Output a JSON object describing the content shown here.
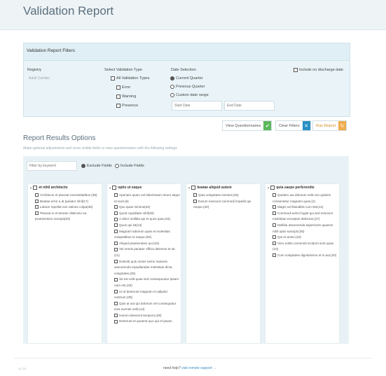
{
  "page": {
    "title": "Validation Report"
  },
  "filters": {
    "title": "Validation Report Filters",
    "registry": {
      "label": "Registry",
      "value": "Adult Cardiac"
    },
    "validation_type": {
      "label": "Select Validation Type",
      "all": "All Validation Types",
      "options": [
        "Error",
        "Warning",
        "Presence"
      ]
    },
    "date_selection": {
      "label": "Date Selection",
      "options": [
        "Current Quarter",
        "Previous Quarter",
        "Custom date range"
      ],
      "start_placeholder": "Start Date",
      "end_placeholder": "End Date"
    },
    "include_no_discharge": "Include no discharge date"
  },
  "buttons": {
    "view_questionnaires": "View Questionnaires",
    "clear_filters": "Clear Filters",
    "run_report": "Run Report",
    "colors": {
      "green": "#5cb85c",
      "blue": "#2a8fc4",
      "orange": "#f0ad4e"
    }
  },
  "results": {
    "title": "Report Results Options",
    "subtitle": "Make optional adjustments and rerun visible fields or view questionnaires with the following settings",
    "filter_placeholder": "Filter by keyword",
    "exclude_label": "Exclude Fields",
    "include_label": "Include Fields",
    "columns": [
      {
        "title": "et nihil architecto",
        "items": [
          "Architecto et placeat necessitatibus (38)",
          "Beatae error a at pariatur nihil(17)",
          "Labore repellat non ratione culpa(36)",
          "Placeat in et tenetur distinctio ea praesentium suscipit(30)"
        ]
      },
      {
        "title": "optio ut eaque",
        "items": [
          "Aperiam quam vel laboriosam rerum atque et sunt.(6)",
          "Quo quae minima(32)",
          "Quod cupiditate nihil(49)",
          "A dolor mollitia qui et quos quia.(34)",
          "Quos qui sit(13)",
          "Magnam laborum quas et molestias voluptatibus et eaque.(50)",
          "Aliquid praesentium qui.(34)",
          "Vel omnis pariatur officia delectus et sit.(11)",
          "Deleniti quis omnis nemo maiores assumenda repudiandae molestiae dicta voluptates.(25)",
          "Sit est velit quae sed consequuntur ipsam nam est.(33)",
          "Ut id deserunt magnam et adipisci nostrum.(39)",
          "Quis at aut qui dolorum vel consequatur eius eveniet velit.(13)",
          "Harum deserunt tempora.(29)",
          "Deserunt et quaerat quo qui et ipsam"
        ]
      },
      {
        "title": "beatae aliquid autem",
        "items": [
          "Quia voluptates eveniet.(26)",
          "Earum nesciunt commodi impedit qui neque.(20)"
        ]
      },
      {
        "title": "quia saepe perferendis",
        "items": [
          "Quidem aut dolorum velit non quidem consectetur magnam quas.(2)",
          "Magni vel blanditiis cum iste(14)",
          "Commodi animi fugiat qui sed nesciunt molestiae excepturi delectus.(27)",
          "Mollitia assumenda asperiores quaerat nihil optio suscipit.(36)",
          "Qui et animi.(16)",
          "Vero nobis commodi incidunt sunt quas.(10)",
          "Cum voluptates dignissimos et in aut.(20)"
        ]
      }
    ]
  },
  "footer": {
    "version": "v2.19",
    "help_text": "need help?",
    "help_link": "visit remote support →"
  }
}
